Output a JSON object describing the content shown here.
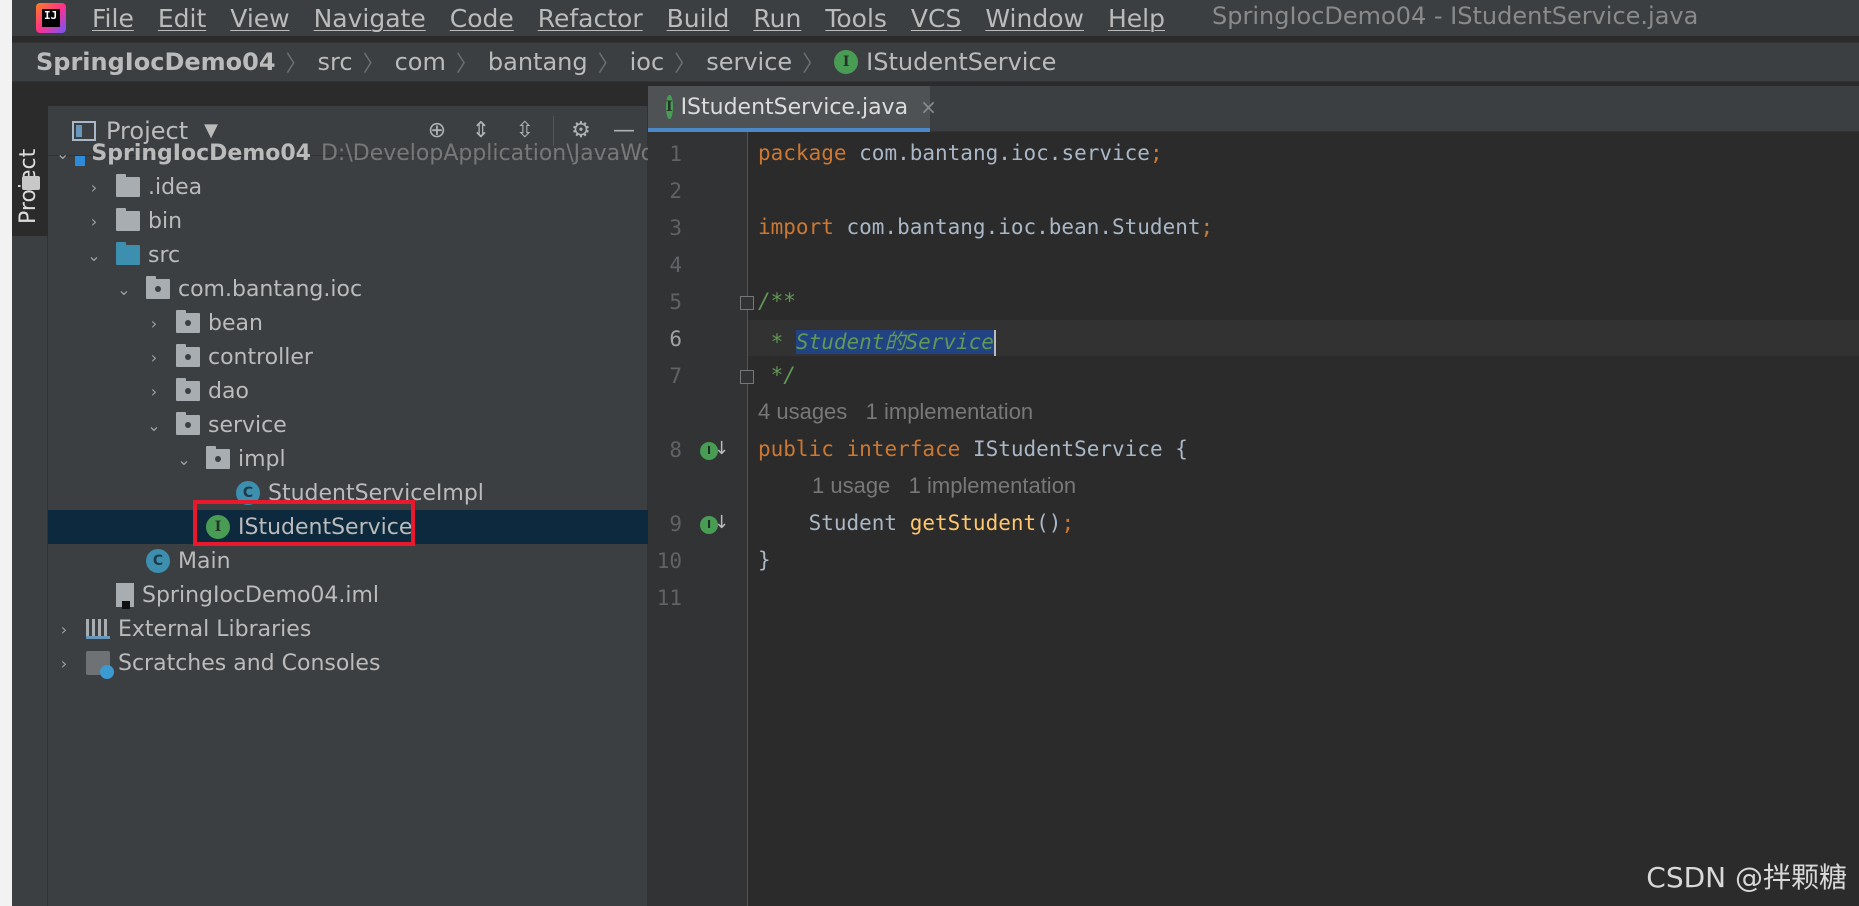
{
  "window_title": "SpringIocDemo04 - IStudentService.java",
  "menu": [
    "File",
    "Edit",
    "View",
    "Navigate",
    "Code",
    "Refactor",
    "Build",
    "Run",
    "Tools",
    "VCS",
    "Window",
    "Help"
  ],
  "breadcrumb": [
    "SpringIocDemo04",
    "src",
    "com",
    "bantang",
    "ioc",
    "service",
    "IStudentService"
  ],
  "side_tab_label": "Project",
  "project_panel": {
    "title": "Project",
    "tree": [
      {
        "label": "SpringIocDemo04",
        "path": "D:\\DevelopApplication\\JavaWorkSp",
        "icon": "module-icon"
      },
      {
        "label": ".idea",
        "icon": "folder-icon"
      },
      {
        "label": "bin",
        "icon": "folder-icon"
      },
      {
        "label": "src",
        "icon": "source-folder-icon"
      },
      {
        "label": "com.bantang.ioc",
        "icon": "package-icon"
      },
      {
        "label": "bean",
        "icon": "package-icon"
      },
      {
        "label": "controller",
        "icon": "package-icon"
      },
      {
        "label": "dao",
        "icon": "package-icon"
      },
      {
        "label": "service",
        "icon": "package-icon"
      },
      {
        "label": "impl",
        "icon": "package-icon"
      },
      {
        "label": "StudentServiceImpl",
        "icon": "class-icon"
      },
      {
        "label": "IStudentService",
        "icon": "interface-icon"
      },
      {
        "label": "Main",
        "icon": "class-icon"
      },
      {
        "label": "SpringIocDemo04.iml",
        "icon": "iml-file-icon"
      },
      {
        "label": "External Libraries",
        "icon": "library-icon"
      },
      {
        "label": "Scratches and Consoles",
        "icon": "scratch-icon"
      }
    ]
  },
  "editor": {
    "tab_label": "IStudentService.java",
    "line_numbers": [
      "1",
      "2",
      "3",
      "4",
      "5",
      "6",
      "7",
      "8",
      "9",
      "10",
      "11"
    ],
    "code": {
      "l1_kw": "package",
      "l1_rest": " com.bantang.ioc.service",
      "l1_semi": ";",
      "l3_kw": "import",
      "l3_rest": " com.bantang.ioc.bean.Student",
      "l3_semi": ";",
      "l5": "/**",
      "l6_prefix": " * ",
      "l6_sel": "Student的Service",
      "l7": " */",
      "hint1": "4 usages   1 implementation",
      "l8_kw1": "public",
      "l8_kw2": "interface",
      "l8_rest": " IStudentService {",
      "hint2": "1 usage   1 implementation",
      "l9_type": "    Student ",
      "l9_method": "getStudent",
      "l9_paren": "()",
      "l9_semi": ";",
      "l10": "}"
    }
  },
  "watermark": "CSDN @拌颗糖",
  "colors": {
    "selection_bg": "#0d293e",
    "keyword": "#cc7832",
    "comment": "#629755",
    "method": "#ffc66d",
    "highlight_box": "#e8192c",
    "interface_icon": "#499c54",
    "class_icon": "#3d8fb0"
  }
}
